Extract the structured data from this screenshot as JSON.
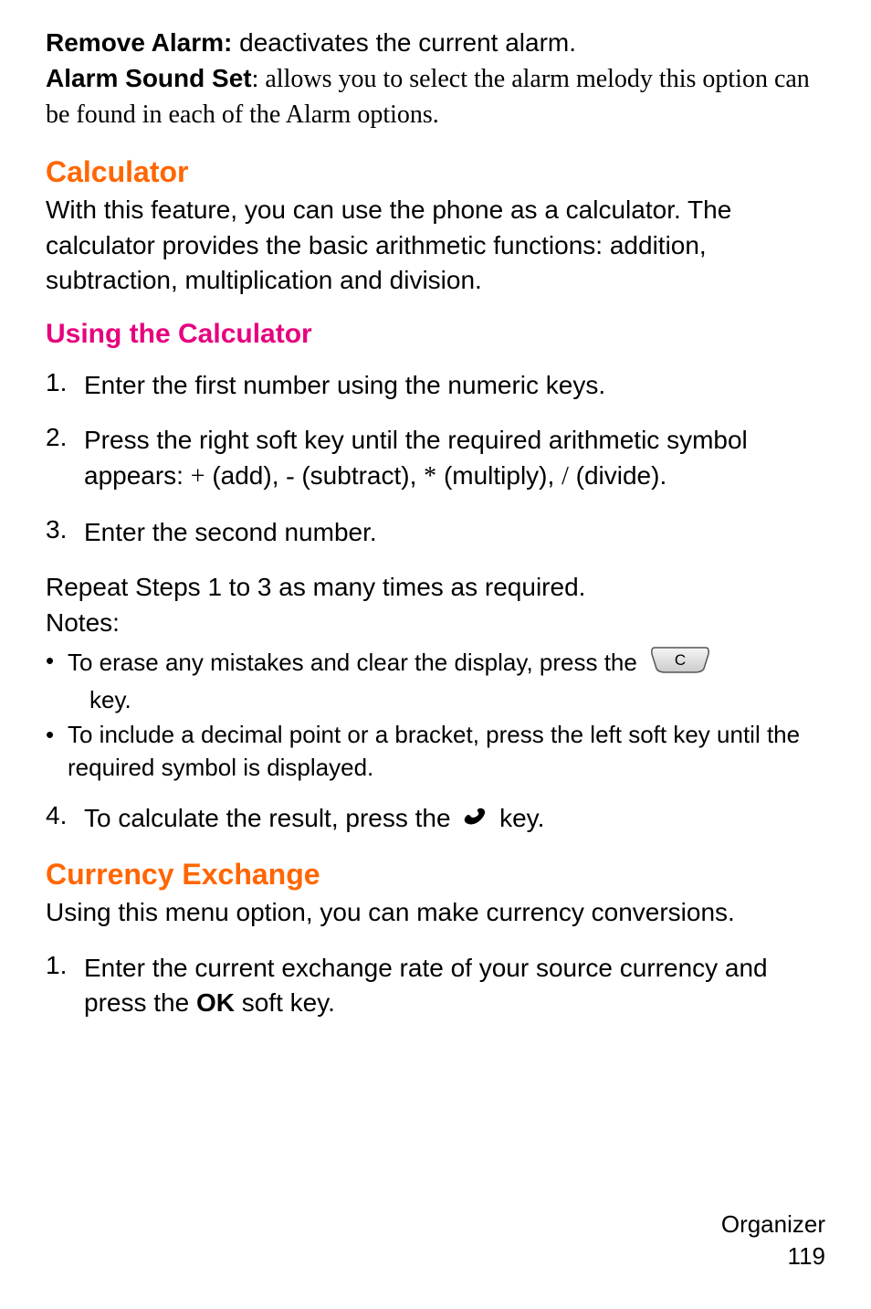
{
  "para1": {
    "bold1": "Remove Alarm: ",
    "text1": "deactivates the current alarm.",
    "bold2": "Alarm Sound Set",
    "text2": ": allows you to select the alarm melody this option can be found in each of the Alarm options."
  },
  "calculator": {
    "heading": "Calculator",
    "text": "With this feature, you can use the phone as a calculator. The calculator provides the basic arithmetic functions: addition, subtraction, multiplication and division."
  },
  "using": {
    "heading": "Using the Calculator"
  },
  "steps1": {
    "num1": "1.",
    "text1": "Enter the first number using the numeric keys.",
    "num2": "2.",
    "text2a": "Press the right soft key until the required arithmetic symbol appears: ",
    "plus": "+",
    "add": " (add), ",
    "minus": "-",
    "sub": " (subtract), ",
    "star": "*",
    "mul": " (multiply), ",
    "slash": "/",
    "div": " (divide).",
    "num3": "3.",
    "text3": "Enter the second number."
  },
  "repeat": "Repeat Steps 1 to 3 as many times as required.",
  "notes": "Notes:",
  "bullets": {
    "b1a": "To erase any mistakes and clear the display, press the ",
    "b1b": "key.",
    "b2": "To include a decimal point or a bracket, press the left soft key until the required symbol is displayed."
  },
  "step4": {
    "num": "4.",
    "text_a": "To calculate the result, press the ",
    "text_b": " key."
  },
  "currency": {
    "heading": "Currency Exchange",
    "text": "Using this menu option, you can make currency conversions."
  },
  "currency_step": {
    "num": "1.",
    "text_a": "Enter the current exchange rate of your source currency and press the ",
    "ok": "OK",
    "text_b": " soft key."
  },
  "footer": {
    "section": "Organizer",
    "page": "119"
  }
}
